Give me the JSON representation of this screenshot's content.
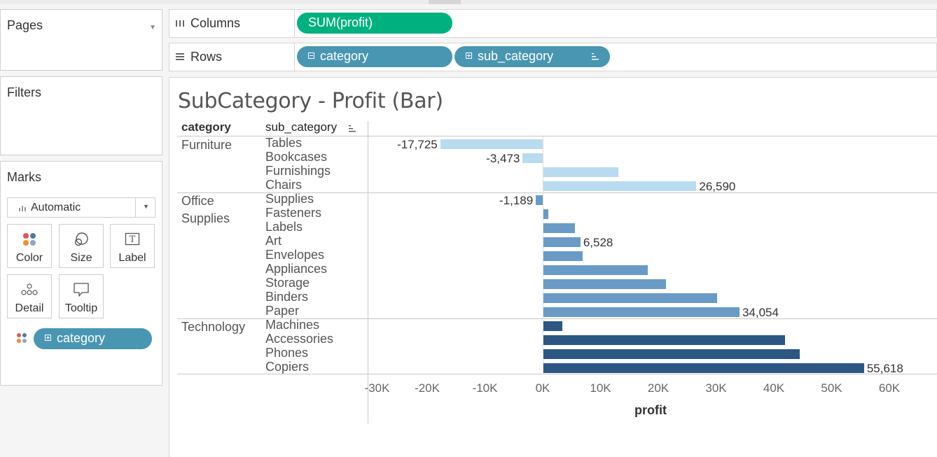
{
  "panels": {
    "pages": "Pages",
    "filters": "Filters",
    "marks": "Marks",
    "mark_type": "Automatic",
    "buttons": {
      "color": "Color",
      "size": "Size",
      "label": "Label",
      "detail": "Detail",
      "tooltip": "Tooltip"
    },
    "color_field": "category"
  },
  "shelves": {
    "columns_label": "Columns",
    "rows_label": "Rows",
    "columns_pill": "SUM(profit)",
    "rows_pills": [
      "category",
      "sub_category"
    ]
  },
  "colors": {
    "columns_pill": "#00b180",
    "rows_pill": "#4996b2",
    "furniture": "#b9dbf0",
    "office_supplies": "#6a9bc6",
    "technology": "#2c5784"
  },
  "view": {
    "title": "SubCategory - Profit (Bar)",
    "col_category": "category",
    "col_sub_category": "sub_category"
  },
  "chart_data": {
    "type": "bar",
    "title": "SubCategory - Profit (Bar)",
    "xlabel": "profit",
    "ylabel": "",
    "xlim": [
      -30000,
      60000
    ],
    "x_ticks": [
      "-30K",
      "-20K",
      "-10K",
      "0K",
      "10K",
      "20K",
      "30K",
      "40K",
      "50K",
      "60K"
    ],
    "groups": [
      {
        "category": "Furniture",
        "label_lines": [
          "Furniture"
        ],
        "color": "#b9dbf0",
        "rows": [
          {
            "sub_category": "Tables",
            "value": -17725,
            "label": "-17,725"
          },
          {
            "sub_category": "Bookcases",
            "value": -3473,
            "label": "-3,473"
          },
          {
            "sub_category": "Furnishings",
            "value": 13059,
            "label": ""
          },
          {
            "sub_category": "Chairs",
            "value": 26590,
            "label": "26,590"
          }
        ]
      },
      {
        "category": "Office Supplies",
        "label_lines": [
          "Office",
          "Supplies"
        ],
        "color": "#6a9bc6",
        "rows": [
          {
            "sub_category": "Supplies",
            "value": -1189,
            "label": "-1,189"
          },
          {
            "sub_category": "Fasteners",
            "value": 950,
            "label": ""
          },
          {
            "sub_category": "Labels",
            "value": 5546,
            "label": ""
          },
          {
            "sub_category": "Art",
            "value": 6528,
            "label": "6,528"
          },
          {
            "sub_category": "Envelopes",
            "value": 6964,
            "label": ""
          },
          {
            "sub_category": "Appliances",
            "value": 18138,
            "label": ""
          },
          {
            "sub_category": "Storage",
            "value": 21279,
            "label": ""
          },
          {
            "sub_category": "Binders",
            "value": 30222,
            "label": ""
          },
          {
            "sub_category": "Paper",
            "value": 34054,
            "label": "34,054"
          }
        ]
      },
      {
        "category": "Technology",
        "label_lines": [
          "Technology"
        ],
        "color": "#2c5784",
        "rows": [
          {
            "sub_category": "Machines",
            "value": 3385,
            "label": ""
          },
          {
            "sub_category": "Accessories",
            "value": 41937,
            "label": ""
          },
          {
            "sub_category": "Phones",
            "value": 44516,
            "label": ""
          },
          {
            "sub_category": "Copiers",
            "value": 55618,
            "label": "55,618"
          }
        ]
      }
    ]
  }
}
